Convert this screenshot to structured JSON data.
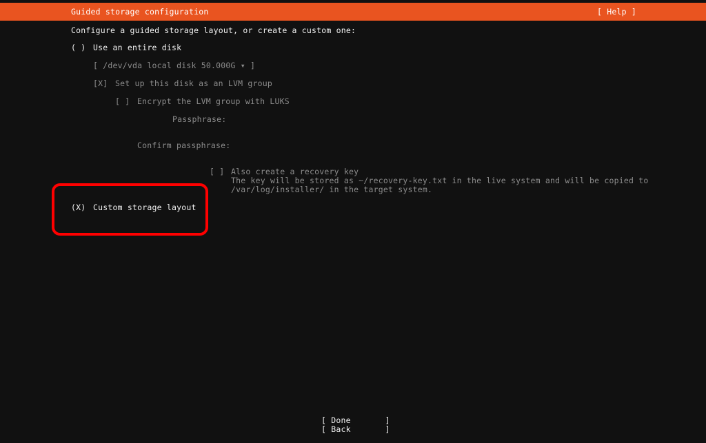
{
  "header": {
    "title": "Guided storage configuration",
    "help_label": "[ Help ]",
    "accent_color": "#e95420"
  },
  "intro": "Configure a guided storage layout, or create a custom one:",
  "entire_disk": {
    "radio": "( )",
    "label": "Use an entire disk",
    "disk_select": "[ /dev/vda local disk 50.000G ▾ ]",
    "lvm": {
      "checkbox": "[X]",
      "label": "Set up this disk as an LVM group"
    },
    "luks": {
      "checkbox": "[ ]",
      "label": "Encrypt the LVM group with LUKS"
    },
    "passphrase_label": "Passphrase:",
    "confirm_passphrase_label": "Confirm passphrase:",
    "recovery": {
      "checkbox": "[ ]",
      "label": "Also create a recovery key",
      "desc_line1": "The key will be stored as ~/recovery-key.txt in the live system and will be copied to",
      "desc_line2": "/var/log/installer/ in the target system."
    }
  },
  "custom_layout": {
    "radio": "(X)",
    "label": "Custom storage layout",
    "highlight_color": "#ff0000"
  },
  "buttons": {
    "done": "[ Done       ]",
    "back": "[ Back       ]"
  }
}
